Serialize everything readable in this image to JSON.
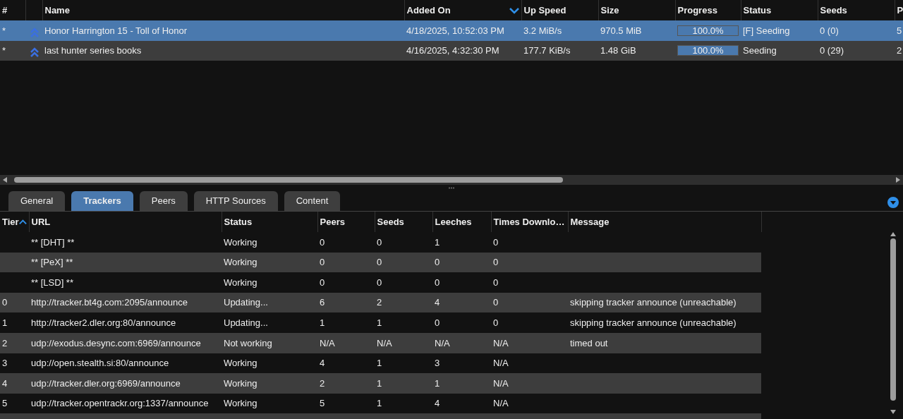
{
  "torrents": {
    "columns": [
      {
        "label": "#"
      },
      {},
      {
        "label": "Name"
      },
      {
        "label": "Added On",
        "sorted": true,
        "descending": true
      },
      {
        "label": "Up Speed"
      },
      {
        "label": "Size"
      },
      {
        "label": "Progress"
      },
      {
        "label": "Status"
      },
      {
        "label": "Seeds"
      },
      {
        "label": "P"
      }
    ],
    "rows": [
      {
        "selected": true,
        "num": "*",
        "name": "Honor Harrington 15 - Toll of Honor",
        "added_on": "4/18/2025, 10:52:03 PM",
        "up_speed": "3.2 MiB/s",
        "size": "970.5 MiB",
        "progress": {
          "level": 1.0,
          "text": "100.0%"
        },
        "status": "[F] Seeding",
        "seeds": "0 (0)",
        "column_10": "5"
      },
      {
        "selected": false,
        "num": "*",
        "name": "last hunter series books",
        "added_on": "4/16/2025, 4:32:30 PM",
        "up_speed": "177.7 KiB/s",
        "size": "1.48 GiB",
        "progress": {
          "level": 1.0,
          "text": "100.0%"
        },
        "status": "Seeding",
        "seeds": "0 (29)",
        "column_10": "2"
      }
    ]
  },
  "tabs": [
    {
      "label": "General",
      "selected": false
    },
    {
      "label": "Trackers",
      "selected": true
    },
    {
      "label": "Peers",
      "selected": false
    },
    {
      "label": "HTTP Sources",
      "selected": false
    },
    {
      "label": "Content",
      "selected": false
    }
  ],
  "trackers": {
    "columns": [
      {
        "label": "Tier",
        "sorted": true,
        "descending": false
      },
      {
        "label": "URL"
      },
      {
        "label": "Status"
      },
      {
        "label": "Peers"
      },
      {
        "label": "Seeds"
      },
      {
        "label": "Leeches"
      },
      {
        "label": "Times Downlo…"
      },
      {
        "label": "Message"
      }
    ],
    "rows": [
      {
        "url": "** [DHT] **",
        "status": "Working",
        "peers": "0",
        "seeds": "0",
        "leeches": "1",
        "times_downloaded": "0"
      },
      {
        "url": "** [PeX] **",
        "status": "Working",
        "peers": "0",
        "seeds": "0",
        "leeches": "0",
        "times_downloaded": "0"
      },
      {
        "url": "** [LSD] **",
        "status": "Working",
        "peers": "0",
        "seeds": "0",
        "leeches": "0",
        "times_downloaded": "0"
      },
      {
        "tier": "0",
        "url": "http://tracker.bt4g.com:2095/announce",
        "status": "Updating...",
        "peers": "6",
        "seeds": "2",
        "leeches": "4",
        "times_downloaded": "0",
        "message": "skipping tracker announce (unreachable)"
      },
      {
        "tier": "1",
        "url": "http://tracker2.dler.org:80/announce",
        "status": "Updating...",
        "peers": "1",
        "seeds": "1",
        "leeches": "0",
        "times_downloaded": "0",
        "message": "skipping tracker announce (unreachable)"
      },
      {
        "tier": "2",
        "url": "udp://exodus.desync.com:6969/announce",
        "status": "Not working",
        "peers": "N/A",
        "seeds": "N/A",
        "leeches": "N/A",
        "times_downloaded": "N/A",
        "message": "timed out"
      },
      {
        "tier": "3",
        "url": "udp://open.stealth.si:80/announce",
        "status": "Working",
        "peers": "4",
        "seeds": "1",
        "leeches": "3",
        "times_downloaded": "N/A"
      },
      {
        "tier": "4",
        "url": "udp://tracker.dler.org:6969/announce",
        "status": "Working",
        "peers": "2",
        "seeds": "1",
        "leeches": "1",
        "times_downloaded": "N/A"
      },
      {
        "tier": "5",
        "url": "udp://tracker.opentrackr.org:1337/announce",
        "status": "Working",
        "peers": "5",
        "seeds": "1",
        "leeches": "4",
        "times_downloaded": "N/A"
      }
    ]
  }
}
